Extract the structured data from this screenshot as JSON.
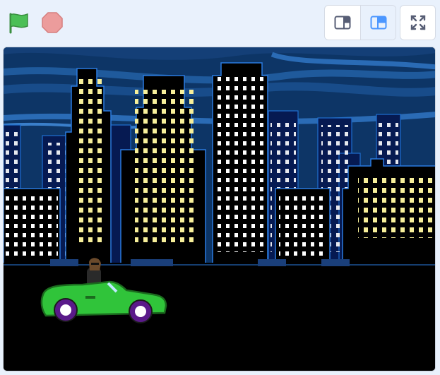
{
  "toolbar": {
    "green_flag_icon": "green-flag-icon",
    "stop_icon": "stop-sign-icon",
    "small_stage_icon": "small-stage-icon",
    "large_stage_icon": "large-stage-icon",
    "fullscreen_icon": "fullscreen-icon",
    "layout_selected": "large-stage"
  },
  "stage": {
    "backdrop": "night-city",
    "sprite": "convertible-car-with-driver"
  },
  "colors": {
    "page_bg": "#e9f1fc",
    "accent": "#4c97ff",
    "flag": "#4cbf56",
    "stop": "#ec9c9c",
    "sky": "#0d3566",
    "window": "#f7ef9a",
    "car": "#30c43a"
  }
}
